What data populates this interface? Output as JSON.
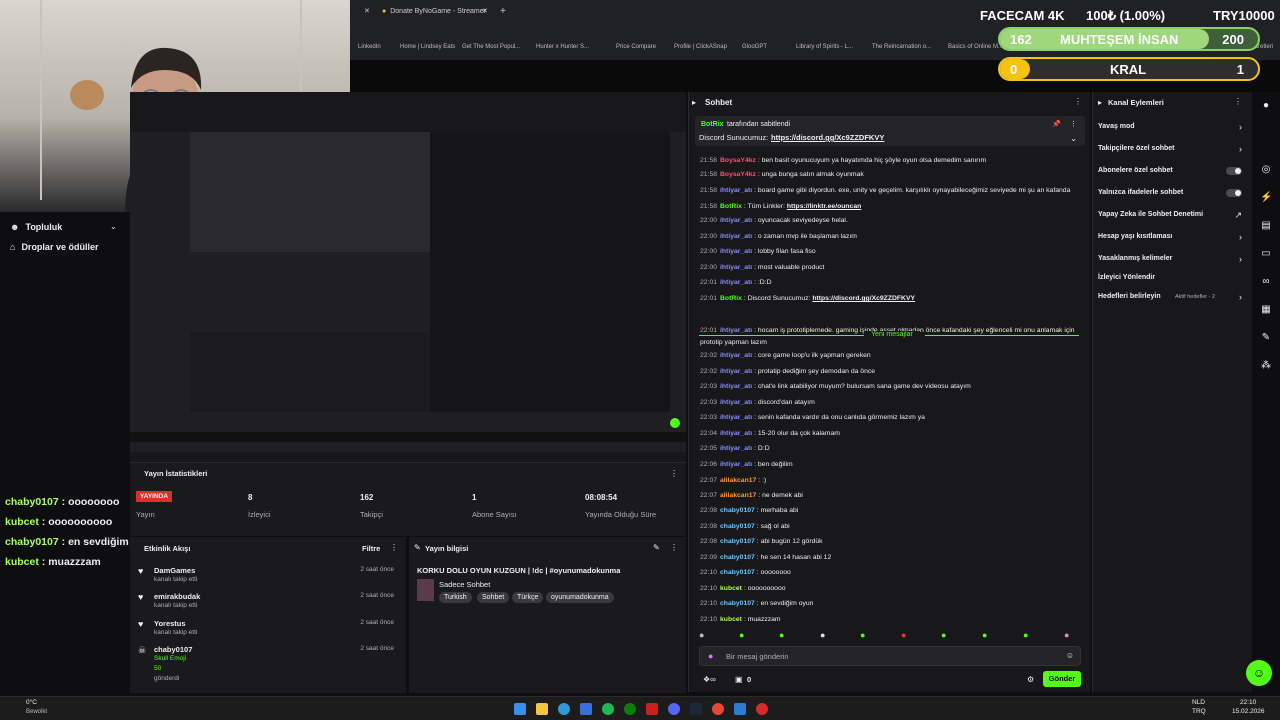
{
  "browser": {
    "tabs": [
      {
        "label": "Donate ByNoGame - Streamer"
      }
    ],
    "bookmarks": [
      "LinkedIn",
      "Home | Lindsey Eats",
      "Get The Most Popul...",
      "Hunter x Hunter S...",
      "Price Compare",
      "Profile | ClickASnap",
      "GlooGPT",
      "Library of Spirits - L...",
      "The Reincarnation o...",
      "Basics of Online M...",
      "Tüm Yer İşaretleri"
    ]
  },
  "overlay": {
    "facecam_label": "FACECAM 4K",
    "progress_text": "100₺ (1.00%)",
    "target_text": "TRY10000",
    "rank1_count": "162",
    "rank1_label": "MUHTEŞEM İNSAN",
    "rank1_target": "200",
    "rank2_count": "0",
    "rank2_label": "KRAL",
    "rank2_target": "1",
    "rank1_progress": 0.81,
    "rank2_progress": 0.0
  },
  "sidebar": {
    "items": [
      {
        "label": "Topluluk",
        "icon": "community-icon"
      },
      {
        "label": "Droplar ve ödüller",
        "icon": "gift-icon"
      }
    ],
    "chat_overlay": [
      {
        "user": "chaby0107",
        "text": "oooooooo",
        "color": "#a8ff60"
      },
      {
        "user": "kubcet",
        "text": "oooooooooo",
        "color": "#a8ff60"
      },
      {
        "user": "chaby0107",
        "text": "en sevdiğim oyun",
        "color": "#a8ff60"
      },
      {
        "user": "kubcet",
        "text": "muazzzam",
        "color": "#a8ff60"
      }
    ]
  },
  "stats": {
    "title": "Yayın İstatistikleri",
    "live_badge": "YAYINDA",
    "items": [
      {
        "value": "",
        "label": "Yayın"
      },
      {
        "value": "8",
        "label": "İzleyici"
      },
      {
        "value": "162",
        "label": "Takipçi"
      },
      {
        "value": "1",
        "label": "Abone Sayısı"
      },
      {
        "value": "08:08:54",
        "label": "Yayında Olduğu Süre"
      }
    ]
  },
  "activity": {
    "title": "Etkinlik Akışı",
    "filter_label": "Filtre",
    "items": [
      {
        "name": "DamGames",
        "sub": "kanalı takip etti",
        "time": "2 saat önce"
      },
      {
        "name": "emirakbudak",
        "sub": "kanalı takip etti",
        "time": "2 saat önce"
      },
      {
        "name": "Yorestus",
        "sub": "kanalı takip etti",
        "time": "2 saat önce"
      },
      {
        "name": "chaby0107",
        "sub": "Skull Emoji",
        "sub2": "50",
        "sub3": "gönderdi",
        "time": "2 saat önce"
      }
    ]
  },
  "stream_info": {
    "header": "Yayın bilgisi",
    "title": "KORKU DOLU OYUN KUZGUN | !dc | #oyunumadokunma",
    "category": "Sadece Sohbet",
    "tags": [
      "Turkish",
      "Sohbet",
      "Türkçe",
      "oyunumadokunma"
    ]
  },
  "chat": {
    "header": "Sohbet",
    "pinned_by": "BotRix",
    "pinned_suffix": "tarafından sabitlendi",
    "pinned_label": "Discord Sunucumuz:",
    "pinned_link": "https://discord.gg/Xc9ZZDFKVY",
    "new_messages_label": "Yeni mesajlar",
    "input_placeholder": "Bir mesaj gönderin",
    "send_label": "Gönder",
    "points": "0",
    "messages": [
      {
        "time": "21:58",
        "user": "BoysaY4kz",
        "text": "ben basit oyunucuyum ya hayatımda hiç şöyle oyun olsa demedim sanırım",
        "color": "#ff4f6e"
      },
      {
        "time": "21:58",
        "user": "BoysaY4kz",
        "text": "unga bunga satın almak oyunmak",
        "color": "#ff4f6e"
      },
      {
        "time": "21:58",
        "user": "ihtiyar_atı",
        "text": "board game gibi diyordun. exe, unity ve geçelim. karşılıklı oynayabileceğimiz seviyede mi şu an kafanda",
        "color": "#8b8bff"
      },
      {
        "time": "21:58",
        "user": "BotRix",
        "text": "Tüm Linkler:",
        "link": "https://linktr.ee/ouncan",
        "color": "#53fc18"
      },
      {
        "time": "22:00",
        "user": "ihtiyar_atı",
        "text": "oyuncacak seviyedeyse helal.",
        "color": "#8b8bff"
      },
      {
        "time": "22:00",
        "user": "ihtiyar_atı",
        "text": "o zaman mvp ile başlaman lazım",
        "color": "#8b8bff"
      },
      {
        "time": "22:00",
        "user": "ihtiyar_atı",
        "text": "lobby filan fasa fiso",
        "color": "#8b8bff"
      },
      {
        "time": "22:00",
        "user": "ihtiyar_atı",
        "text": "most valuable product",
        "color": "#8b8bff"
      },
      {
        "time": "22:01",
        "user": "ihtiyar_atı",
        "text": ":D:D",
        "color": "#8b8bff"
      },
      {
        "time": "22:01",
        "user": "BotRix",
        "text": "Discord Sunucumuz:",
        "link": "https://discord.gg/Xc9ZZDFKVY",
        "color": "#53fc18"
      },
      {
        "time": "22:01",
        "user": "ihtiyar_atı",
        "text": "hocam iş prototiplemede. gaming işinde asset olmadan önce kafandaki şey eğlenceli mi onu anlamak için",
        "color": "#8b8bff"
      },
      {
        "time": "",
        "user": "",
        "text": "prototip yapman lazım",
        "color": "#efeff1"
      },
      {
        "time": "22:02",
        "user": "ihtiyar_atı",
        "text": "core game loop'u ilk yapman gereken",
        "color": "#8b8bff"
      },
      {
        "time": "22:02",
        "user": "ihtiyar_atı",
        "text": "protatip dediğim şey demodan da önce",
        "color": "#8b8bff"
      },
      {
        "time": "22:03",
        "user": "ihtiyar_atı",
        "text": "chat'e link atabiliyor muyum? bulursam sana game dev videosu atayım",
        "color": "#8b8bff"
      },
      {
        "time": "22:03",
        "user": "ihtiyar_atı",
        "text": "discord'dan atayım",
        "color": "#8b8bff"
      },
      {
        "time": "22:03",
        "user": "ihtiyar_atı",
        "text": "senin kafanda vardır da onu canlıda görmemiz lazım ya",
        "color": "#8b8bff"
      },
      {
        "time": "22:04",
        "user": "ihtiyar_atı",
        "text": "15-20 olur da çok kalamam",
        "color": "#8b8bff"
      },
      {
        "time": "22:05",
        "user": "ihtiyar_atı",
        "text": "D:D",
        "color": "#8b8bff"
      },
      {
        "time": "22:06",
        "user": "ihtiyar_atı",
        "text": "ben değilim",
        "color": "#8b8bff"
      },
      {
        "time": "22:07",
        "user": "alilakcan17",
        "text": ":)",
        "color": "#ff9a2e"
      },
      {
        "time": "22:07",
        "user": "alilakcan17",
        "text": "ne demek abi",
        "color": "#ff9a2e"
      },
      {
        "time": "22:08",
        "user": "chaby0107",
        "text": "merhaba abi",
        "color": "#6ec6ff"
      },
      {
        "time": "22:08",
        "user": "chaby0107",
        "text": "sağ ol abi",
        "color": "#6ec6ff"
      },
      {
        "time": "22:08",
        "user": "chaby0107",
        "text": "abi bugün 12 gördük",
        "color": "#6ec6ff"
      },
      {
        "time": "22:09",
        "user": "chaby0107",
        "text": "he sen 14 hasan abi 12",
        "color": "#6ec6ff"
      },
      {
        "time": "22:10",
        "user": "chaby0107",
        "text": "oooooooo",
        "color": "#6ec6ff"
      },
      {
        "time": "22:10",
        "user": "kubcet",
        "text": "oooooooooo",
        "color": "#a8ff60"
      },
      {
        "time": "22:10",
        "user": "chaby0107",
        "text": "en sevdiğim oyun",
        "color": "#6ec6ff"
      },
      {
        "time": "22:10",
        "user": "kubcet",
        "text": "muazzzam",
        "color": "#a8ff60"
      }
    ]
  },
  "channel_actions": {
    "header": "Kanal Eylemleri",
    "items": [
      {
        "label": "Yavaş mod",
        "control": "chevron"
      },
      {
        "label": "Takipçilere özel sohbet",
        "control": "chevron"
      },
      {
        "label": "Abonelere özel sohbet",
        "control": "toggle"
      },
      {
        "label": "Yalnızca ifadelerle sohbet",
        "control": "toggle"
      },
      {
        "label": "Yapay Zeka ile Sohbet Denetimi",
        "control": "external"
      },
      {
        "label": "Hesap yaşı kısıtlaması",
        "control": "chevron"
      },
      {
        "label": "Yasaklanmış kelimeler",
        "control": "chevron"
      },
      {
        "label": "İzleyici Yönlendir",
        "control": "none"
      },
      {
        "label": "Hedefleri belirleyin",
        "control": "chevron",
        "badge": "Aktif hedefler - 2"
      }
    ]
  },
  "taskbar": {
    "weather_temp": "0°C",
    "weather_desc": "Bewolkt",
    "lang": "NLD",
    "lang2": "TRQ",
    "time": "22:10",
    "date": "15.02.2026"
  },
  "colors": {
    "accent": "#53fc18",
    "live": "#d6322a"
  }
}
